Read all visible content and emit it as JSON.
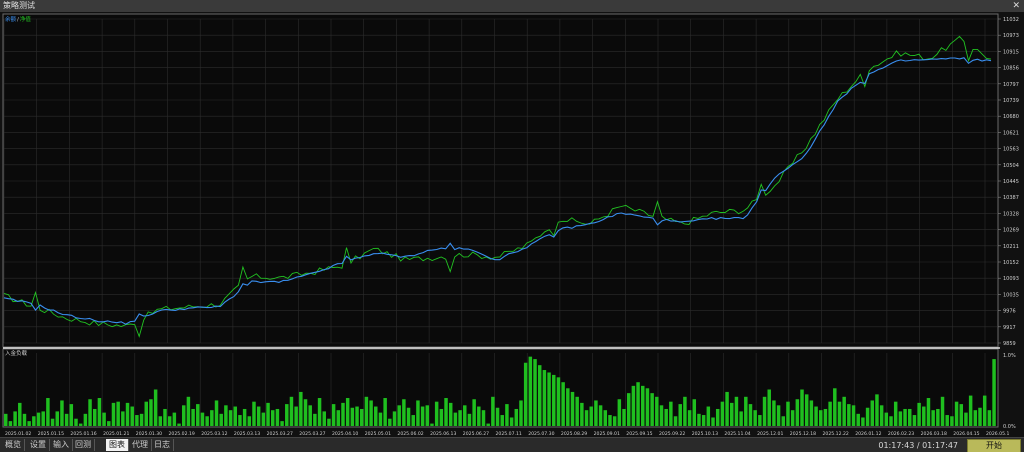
{
  "window": {
    "title": "策略测试",
    "close": "✕"
  },
  "main_chart": {
    "legend_a": "余额",
    "legend_sep": "/",
    "legend_b": "净值",
    "y_ticks": [
      "11032",
      "10973",
      "10915",
      "10856",
      "10797",
      "10739",
      "10680",
      "10621",
      "10563",
      "10504",
      "10445",
      "10387",
      "10328",
      "10269",
      "10211",
      "10152",
      "10093",
      "10035",
      "9976",
      "9917",
      "9859"
    ],
    "colors": {
      "balance": "#3a8ff0",
      "equity": "#22c322",
      "grid": "#2c2c2c"
    }
  },
  "sub_chart": {
    "label": "入金负载",
    "y_ticks": [
      "1.0%",
      "0.0%"
    ],
    "color": "#1fbf1f"
  },
  "chart_data": {
    "type": "line",
    "x_labels": [
      "2025.01.02",
      "2025.01.15",
      "2025.01.16",
      "2025.01.21",
      "2025.01.30",
      "2025.02.19",
      "2025.03.12",
      "2025.03.13",
      "2025.03.27",
      "2025.03.27",
      "2025.04.10",
      "2025.05.01",
      "2025.06.02",
      "2025.06.13",
      "2025.06.27",
      "2025.07.11",
      "2025.07.30",
      "2025.08.29",
      "2025.09.01",
      "2025.09.15",
      "2025.09.22",
      "2025.10.13",
      "2025.11.04",
      "2025.12.01",
      "2025.12.18",
      "2025.12.22",
      "2026.01.12",
      "2026.02.23",
      "2026.03.18",
      "2026.04.15",
      "2026.05.1"
    ],
    "ylim": [
      9859,
      11032
    ],
    "series": [
      {
        "name": "余额",
        "values": [
          10020,
          10000,
          9960,
          9940,
          9930,
          9975,
          9985,
          9990,
          10080,
          10080,
          10110,
          10150,
          10185,
          10170,
          10200,
          10200,
          10160,
          10210,
          10270,
          10290,
          10330,
          10310,
          10295,
          10310,
          10310,
          10460,
          10540,
          10730,
          10830,
          10880,
          10885,
          10890,
          10880
        ]
      },
      {
        "name": "净值",
        "values": [
          10030,
          9990,
          9950,
          9930,
          9920,
          9980,
          9990,
          10000,
          10100,
          10095,
          10115,
          10140,
          10200,
          10160,
          10170,
          10180,
          10170,
          10215,
          10310,
          10290,
          10355,
          10320,
          10290,
          10330,
          10340,
          10430,
          10570,
          10740,
          10850,
          10910,
          10890,
          10960,
          10885
        ]
      }
    ],
    "load_values": [
      10,
      4,
      12,
      19,
      10,
      4,
      8,
      11,
      12,
      23,
      6,
      12,
      21,
      10,
      18,
      6,
      2,
      10,
      22,
      14,
      23,
      11,
      4,
      19,
      20,
      12,
      19,
      16,
      9,
      10,
      20,
      22,
      30,
      8,
      14,
      8,
      11,
      2,
      17,
      24,
      14,
      18,
      11,
      8,
      13,
      21,
      10,
      17,
      13,
      16,
      9,
      14,
      8,
      20,
      16,
      11,
      19,
      13,
      14,
      4,
      18,
      24,
      16,
      28,
      22,
      17,
      10,
      23,
      12,
      6,
      18,
      13,
      19,
      23,
      15,
      16,
      14,
      24,
      21,
      16,
      11,
      23,
      6,
      12,
      17,
      22,
      15,
      9,
      21,
      16,
      17,
      2,
      20,
      14,
      23,
      19,
      11,
      13,
      17,
      10,
      22,
      16,
      13,
      2,
      24,
      15,
      9,
      18,
      7,
      14,
      21,
      52,
      57,
      55,
      50,
      46,
      44,
      42,
      40,
      36,
      31,
      28,
      24,
      19,
      13,
      16,
      21,
      17,
      13,
      9,
      8,
      22,
      14,
      27,
      33,
      36,
      33,
      31,
      27,
      24,
      17,
      14,
      20,
      8,
      18,
      24,
      13,
      22,
      10,
      9,
      16,
      7,
      14,
      20,
      28,
      19,
      24,
      12,
      24,
      18,
      13,
      9,
      24,
      30,
      21,
      17,
      8,
      20,
      13,
      22,
      30,
      26,
      21,
      16,
      13,
      14,
      20,
      31,
      20,
      24,
      18,
      17,
      10,
      7,
      15,
      21,
      26,
      17,
      11,
      8,
      20,
      12,
      14,
      14,
      9,
      19,
      16,
      23,
      13,
      14,
      24,
      9,
      8,
      20,
      18,
      11,
      25,
      13,
      15,
      25,
      13,
      55
    ]
  },
  "tabs": [
    "概览",
    "设置",
    "输入",
    "回测",
    "图表",
    "代理",
    "日志"
  ],
  "active_tab": "图表",
  "status": {
    "time": "01:17:43 / 01:17:47",
    "start": "开始"
  }
}
